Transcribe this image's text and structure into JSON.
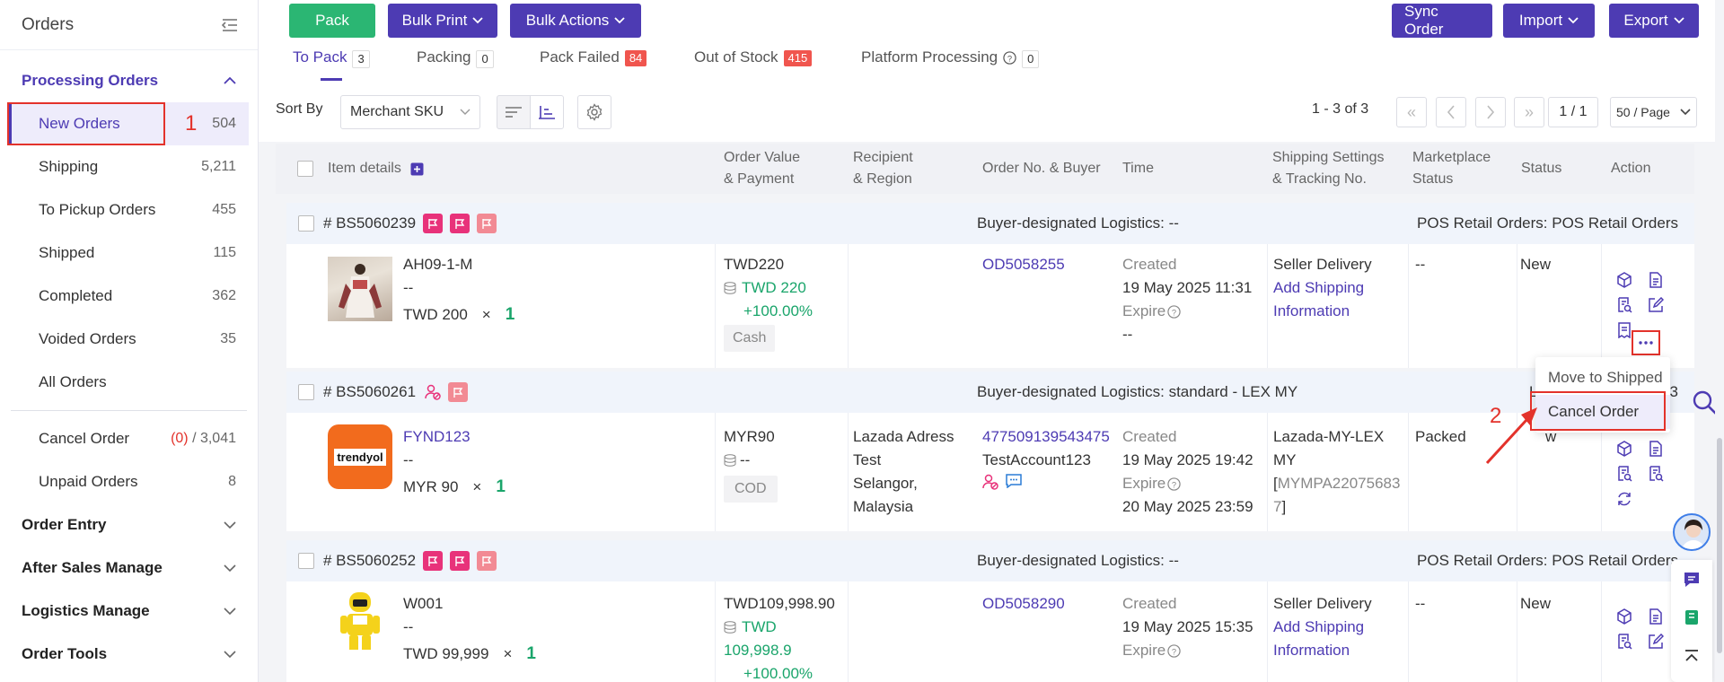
{
  "sidebar": {
    "title": "Orders",
    "groups": {
      "processing": "Processing Orders",
      "order_entry": "Order Entry",
      "after_sales": "After Sales Manage",
      "logistics": "Logistics Manage",
      "order_tools": "Order Tools"
    },
    "items": [
      {
        "label": "New Orders",
        "count": "504"
      },
      {
        "label": "Shipping",
        "count": "5,211"
      },
      {
        "label": "To Pickup Orders",
        "count": "455"
      },
      {
        "label": "Shipped",
        "count": "115"
      },
      {
        "label": "Completed",
        "count": "362"
      },
      {
        "label": "Voided Orders",
        "count": "35"
      },
      {
        "label": "All Orders",
        "count": ""
      }
    ],
    "cancel": {
      "label": "Cancel Order",
      "open": "(0)",
      "total": " / 3,041"
    },
    "unpaid": {
      "label": "Unpaid Orders",
      "count": "8"
    }
  },
  "toolbar": {
    "pack": "Pack",
    "bulk_print": "Bulk Print",
    "bulk_actions": "Bulk Actions",
    "sync_order": "Sync Order",
    "import": "Import",
    "export": "Export"
  },
  "tabs": [
    {
      "label": "To Pack",
      "count": "3"
    },
    {
      "label": "Packing",
      "count": "0"
    },
    {
      "label": "Pack Failed",
      "count": "84"
    },
    {
      "label": "Out of Stock",
      "count": "415"
    },
    {
      "label": "Platform Processing",
      "count": "0"
    }
  ],
  "sort": {
    "label": "Sort By",
    "value": "Merchant SKU"
  },
  "pagination": {
    "range": "1 - 3 of 3",
    "page": "1 / 1",
    "per_page": "50 / Page"
  },
  "table": {
    "headers": {
      "item": "Item details",
      "value1": "Order Value",
      "value2": "& Payment",
      "recip1": "Recipient",
      "recip2": "& Region",
      "orderno": "Order No. & Buyer",
      "time": "Time",
      "ship1": "Shipping Settings",
      "ship2": "& Tracking No.",
      "mkt1": "Marketplace",
      "mkt2": "Status",
      "status": "Status",
      "action": "Action"
    }
  },
  "orders": [
    {
      "id": "# BS5060239",
      "logistics": "Buyer-designated Logistics: --",
      "retail": "POS Retail Orders: POS Retail Orders",
      "sku": "AH09-1-M",
      "variant": "--",
      "price": "TWD 200",
      "times": "×",
      "qty": "1",
      "value": "TWD220",
      "value2": "TWD 220",
      "pct": "+100.00%",
      "payment": "Cash",
      "order_no": "OD5058255",
      "created_label": "Created",
      "created": "19 May 2025 11:31",
      "expire_label": "Expire",
      "expire": "--",
      "ship1": "Seller Delivery",
      "ship2": "Add Shipping",
      "ship3": "Information",
      "market": "--",
      "status": "New"
    },
    {
      "id": "# BS5060261",
      "logistics": "Buyer-designated Logistics: standard - LEX MY",
      "retail": "L",
      "retail_end": "3",
      "sku": "FYND123",
      "variant": "--",
      "price": "MYR 90",
      "times": "×",
      "qty": "1",
      "value": "MYR90",
      "value2": "--",
      "payment": "COD",
      "recip1": "Lazada Adress",
      "recip2": "Test",
      "recip3": "Selangor,",
      "recip4": "Malaysia",
      "order_no": "477509139543475",
      "buyer": "TestAccount123",
      "created_label": "Created",
      "created": "19 May 2025 19:42",
      "expire_label": "Expire",
      "expire": "20 May 2025 23:59",
      "ship1": "Lazada-MY-LEX",
      "ship2": "MY",
      "track_open": "[",
      "track1": "MYMPA22075683",
      "track2": "7",
      "track_close": "]",
      "market": "Packed",
      "status": "w"
    },
    {
      "id": "# BS5060252",
      "logistics": "Buyer-designated Logistics: --",
      "retail": "POS Retail Orders: POS Retail Orders",
      "sku": "W001",
      "variant": "--",
      "price": "TWD 99,999",
      "times": "×",
      "qty": "1",
      "value": "TWD109,998.90",
      "value2a": "TWD",
      "value2b": "109,998.9",
      "pct": "+100.00%",
      "order_no": "OD5058290",
      "created_label": "Created",
      "created": "19 May 2025 15:35",
      "expire_label": "Expire",
      "ship1": "Seller Delivery",
      "ship2": "Add Shipping",
      "ship3": "Information",
      "market": "--",
      "status": "New"
    }
  ],
  "thumb2_text": "trendyol",
  "dropdown": {
    "move": "Move to Shipped",
    "cancel": "Cancel Order"
  },
  "annotations": {
    "n1": "1",
    "n2": "2"
  },
  "colors": {
    "brand": "#4d3bb3",
    "pack": "#2bb673",
    "badge_red": "#f0554e",
    "annotation": "#e3322b"
  }
}
